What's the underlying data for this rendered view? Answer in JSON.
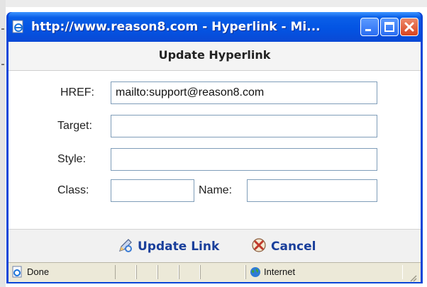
{
  "window": {
    "title": "http://www.reason8.com - Hyperlink - Mi..."
  },
  "dialog": {
    "title": "Update Hyperlink"
  },
  "form": {
    "href_label": "HREF:",
    "href_value": "mailto:support@reason8.com",
    "target_label": "Target:",
    "target_value": "",
    "style_label": "Style:",
    "style_value": "",
    "class_label": "Class:",
    "class_value": "",
    "name_label": "Name:",
    "name_value": ""
  },
  "footer": {
    "update_label": "Update Link",
    "cancel_label": "Cancel"
  },
  "statusbar": {
    "status_text": "Done",
    "zone_text": "Internet"
  },
  "colors": {
    "titlebar": "#0354e3",
    "link_text": "#1a3f9b"
  },
  "icons": {
    "title": "ie-page-icon",
    "update": "pencil-link-icon",
    "cancel": "cancel-x-icon",
    "status": "ie-page-icon",
    "zone": "globe-icon"
  }
}
